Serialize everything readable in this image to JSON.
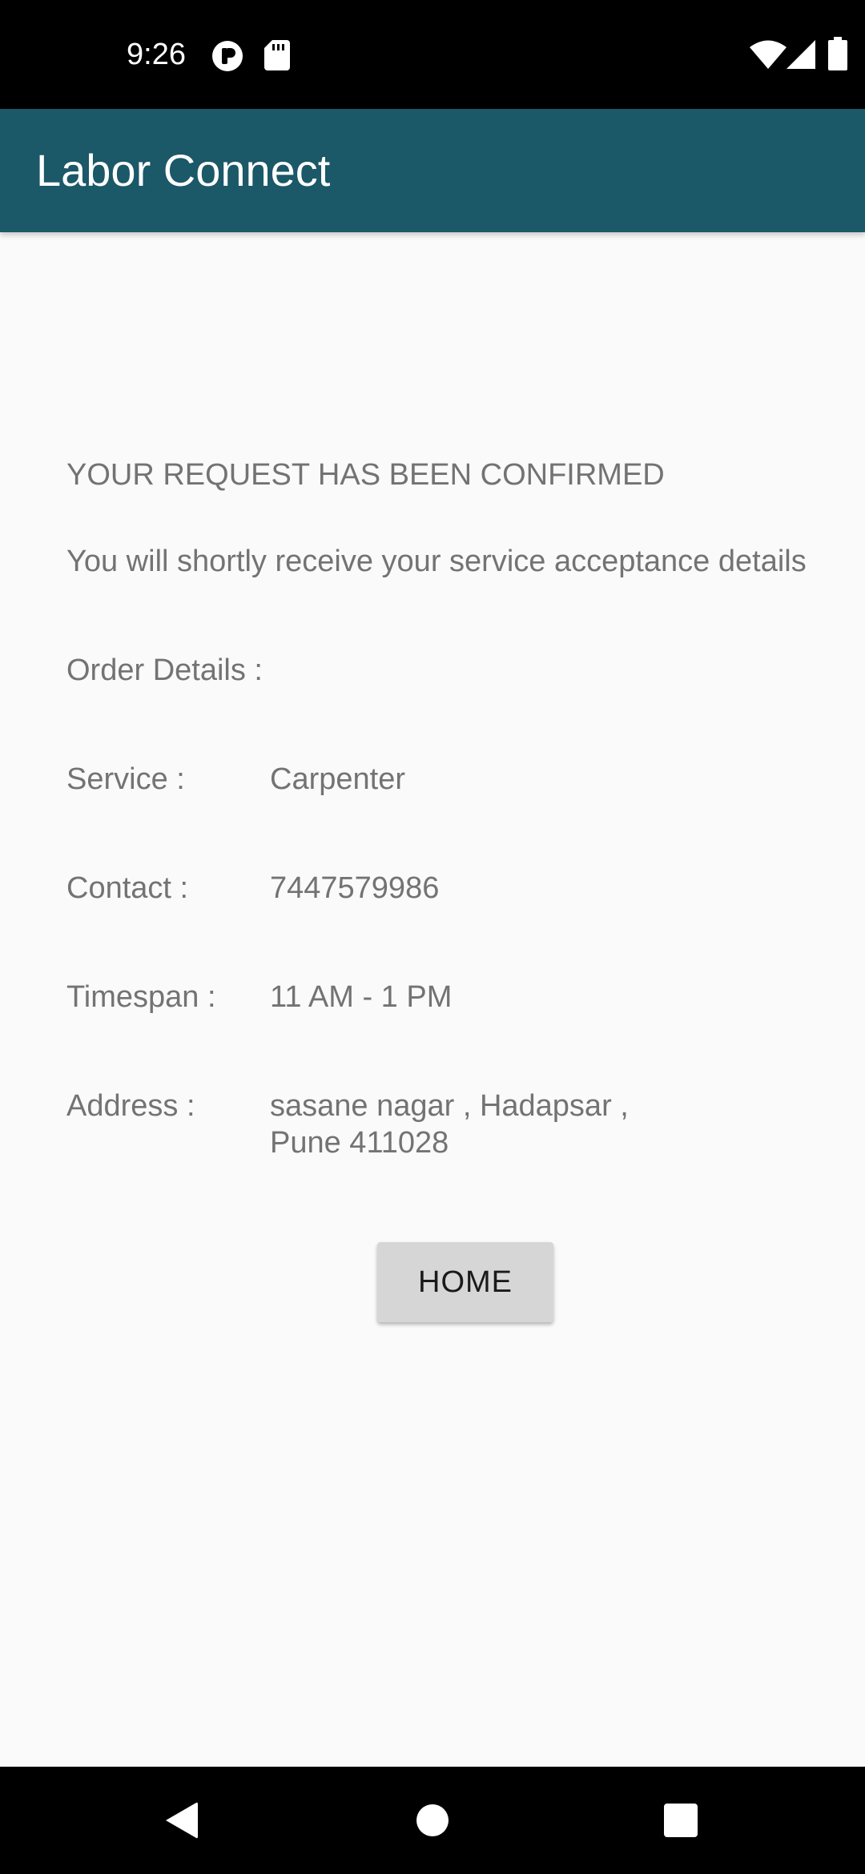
{
  "status_bar": {
    "time": "9:26",
    "icons": [
      "notification-app-icon",
      "sd-card-icon",
      "wifi-icon",
      "cellular-signal-icon",
      "battery-icon"
    ]
  },
  "app_bar": {
    "title": "Labor Connect",
    "color": "#1b5868"
  },
  "confirmation": {
    "heading": "YOUR REQUEST HAS BEEN CONFIRMED",
    "message": "You will shortly receive your service acceptance details"
  },
  "order": {
    "label": "Order Details :",
    "rows": [
      {
        "label": "Service :",
        "value": "Carpenter"
      },
      {
        "label": "Contact :",
        "value": "7447579986"
      },
      {
        "label": "Timespan :",
        "value": "11 AM - 1 PM"
      },
      {
        "label": "Address :",
        "value": "sasane nagar  , Hadapsar  ,\nPune 411028"
      }
    ]
  },
  "home_button": {
    "label": "HOME"
  },
  "nav_bar": {
    "buttons": [
      "back-icon",
      "home-icon",
      "recents-icon"
    ]
  }
}
